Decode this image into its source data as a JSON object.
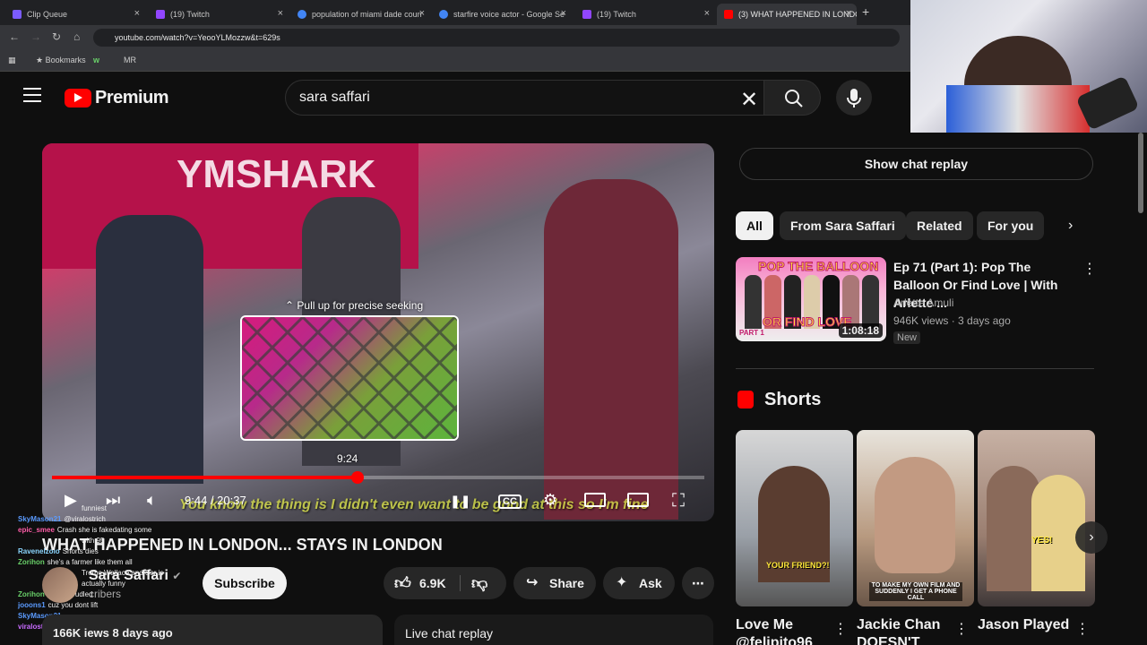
{
  "browser": {
    "tabs": [
      {
        "label": "Clip Queue",
        "color": "#7b5cff"
      },
      {
        "label": "(19) Twitch",
        "color": "#9146ff"
      },
      {
        "label": "population of miami dade coun",
        "color": "#4285f4"
      },
      {
        "label": "starfire voice actor - Google Se",
        "color": "#4285f4"
      },
      {
        "label": "(19) Twitch",
        "color": "#9146ff"
      },
      {
        "label": "(3) WHAT HAPPENED IN LONDO",
        "color": "#ff0000"
      }
    ],
    "url": "youtube.com/watch?v=YeooYLMozzw&t=629s",
    "bookmarks": [
      "Bookmarks",
      "w",
      "MR"
    ]
  },
  "header": {
    "logo_text": "Premium",
    "search_value": "sara saffari"
  },
  "player": {
    "seek_hint": "Pull up for precise seeking",
    "preview_time": "9:24",
    "time_display": "9:44 / 20:37",
    "progress": 0.469,
    "subtitle": "You know the thing is I didn't even want to be good at this so I'm fine"
  },
  "chat_overlay": [
    {
      "user": "",
      "msg": "funniest",
      "color": "#fff"
    },
    {
      "user": "SkyMason21",
      "msg": "@viralostrich",
      "color": "#5b9bff"
    },
    {
      "user": "epic_smee",
      "msg": "Crash she is fakedating some",
      "color": "#ff5ca8"
    },
    {
      "user": "",
      "msg": "with 95",
      "color": "#fff"
    },
    {
      "user": "Ravenelzolo",
      "msg": "Shorts dies",
      "color": "#8bd6ff"
    },
    {
      "user": "Zorihon",
      "msg": "she's a farmer like them all",
      "color": "#6ad16a"
    },
    {
      "user": "",
      "msg": "Treme Wallace and Sar is",
      "color": "#fff"
    },
    {
      "user": "",
      "msg": "actually funny",
      "color": "#fff"
    },
    {
      "user": "Zorihon",
      "msg": "agent strudled",
      "color": "#6ad16a"
    },
    {
      "user": "jooons1",
      "msg": "cuz you dont lift",
      "color": "#5b9bff"
    },
    {
      "user": "SkyMason21",
      "msg": "",
      "color": "#5b9bff"
    },
    {
      "user": "viralostrich",
      "msg": "@SkyMason21",
      "color": "#c86bff"
    }
  ],
  "video": {
    "title": "WHAT HAPPENED IN LONDON... STAYS IN LONDON",
    "channel": "Sara Saffari",
    "subs": "cribers",
    "subscribe_label": "Subscribe",
    "likes": "6.9K",
    "share_label": "Share",
    "ask_label": "Ask",
    "views_part": "166K",
    "views_word": "iews",
    "ago": "8 days ago",
    "live_chat_label": "Live chat replay"
  },
  "sidebar": {
    "chat_replay_label": "Show chat replay",
    "chips": [
      "All",
      "From Sara Saffari",
      "Related",
      "For you"
    ],
    "recommended": {
      "title": "Ep 71 (Part 1): Pop The Balloon Or Find Love | With Arlette ...",
      "channel": "Arlette Amuli",
      "meta": "946K views · 3 days ago",
      "badge": "New",
      "duration": "1:08:18",
      "thumb_text": "POP THE BALLOON",
      "thumb_text2": "OR FIND LOVE",
      "thumb_text3": "PART 1"
    },
    "shorts_heading": "Shorts",
    "shorts": [
      {
        "title": "Love Me @felipito96",
        "overlay": "YOUR FRIEND?!"
      },
      {
        "title": "Jackie Chan DOESN'T",
        "overlay": "TO MAKE MY OWN FILM AND SUDDENLY I GET A PHONE CALL"
      },
      {
        "title": "Jason Played",
        "overlay": "YES!"
      }
    ]
  }
}
